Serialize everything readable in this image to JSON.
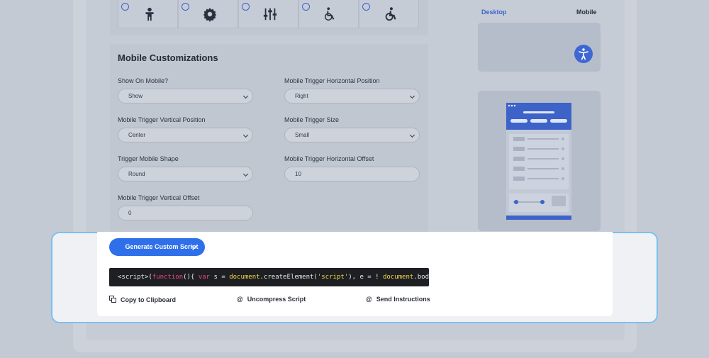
{
  "preview": {
    "tab_desktop": "Desktop",
    "tab_mobile": "Mobile"
  },
  "icons": [
    "person-icon",
    "gear-icon",
    "sliders-icon",
    "wheelchair-icon",
    "wheelchair-active-icon"
  ],
  "mobile_customizations": {
    "title": "Mobile Customizations",
    "fields": {
      "show_on_mobile": {
        "label": "Show On Mobile?",
        "value": "Show"
      },
      "horizontal_position": {
        "label": "Mobile Trigger Horizontal Position",
        "value": "Right"
      },
      "vertical_position": {
        "label": "Mobile Trigger Vertical Position",
        "value": "Center"
      },
      "trigger_size": {
        "label": "Mobile Trigger Size",
        "value": "Small"
      },
      "trigger_shape": {
        "label": "Trigger Mobile Shape",
        "value": "Round"
      },
      "horizontal_offset": {
        "label": "Mobile Trigger Horizontal Offset",
        "value": "10"
      },
      "vertical_offset": {
        "label": "Mobile Trigger Vertical Offset",
        "value": "0"
      }
    }
  },
  "script_section": {
    "generate_label": "Generate Custom Script",
    "code_parts": {
      "p1": "<script>(",
      "p2": "function",
      "p3": "(){ ",
      "p4": "var",
      "p5": " s = ",
      "p6": "document",
      "p7": ".createElement(",
      "p8": "'script'",
      "p9": "), e = ! ",
      "p10": "document",
      "p11": ".body"
    },
    "actions": {
      "copy": "Copy to Clipboard",
      "uncompress": "Uncompress Script",
      "send": "Send Instructions"
    }
  },
  "colors": {
    "accent": "#2f6fea",
    "highlight_border": "#7cc0ee",
    "code_bg": "#1e1f22"
  }
}
